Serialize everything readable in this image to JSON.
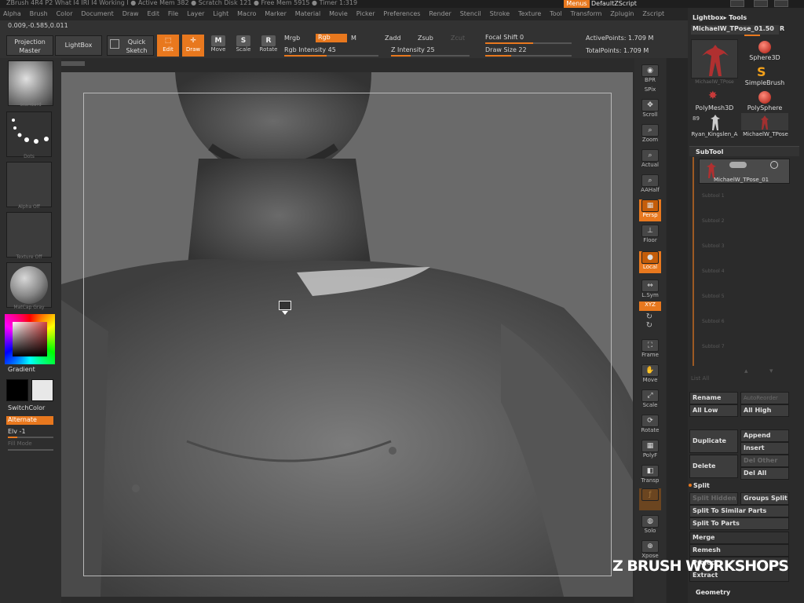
{
  "title_bar": {
    "text": "ZBrush 4R4 P2   What I4 IRI I4 Working I   ● Active Mem 382 ● Scratch Disk 121 ● Free Mem 5915 ● Timer 1:319",
    "menus_label": "Menus",
    "script_label": "DefaultZScript"
  },
  "menu": [
    "Alpha",
    "Brush",
    "Color",
    "Document",
    "Draw",
    "Edit",
    "File",
    "Layer",
    "Light",
    "Macro",
    "Marker",
    "Material",
    "Movie",
    "Picker",
    "Preferences",
    "Render",
    "Stencil",
    "Stroke",
    "Texture",
    "Tool",
    "Transform",
    "Zplugin",
    "Zscript"
  ],
  "toolbar": {
    "coords": "0.009,-0.585,0.011",
    "projection_master": "Projection Master",
    "lightbox": "LightBox",
    "quick_sketch": "Quick Sketch",
    "edit": "Edit",
    "draw": "Draw",
    "move": "Move",
    "scale": "Scale",
    "rotate": "Rotate",
    "mrgb": "Mrgb",
    "rgb": "Rgb",
    "m": "M",
    "rgb_intensity": "Rgb Intensity 45",
    "rgb_intensity_value": 45,
    "zadd": "Zadd",
    "zsub": "Zsub",
    "zcut": "Zcut",
    "z_intensity": "Z Intensity 25",
    "z_intensity_value": 25,
    "focal_shift": "Focal Shift 0",
    "draw_size": "Draw Size 22",
    "active_points": "ActivePoints: 1.709 M",
    "total_points": "TotalPoints: 1.709 M"
  },
  "left": {
    "brush_label": "Standard",
    "stroke_label": "Dots",
    "alpha_label": "Alpha  Off",
    "texture_label": "Texture  Off",
    "material_label": "MatCap  Gray",
    "gradient": "Gradient",
    "switch_color": "SwitchColor",
    "alternate": "Alternate",
    "elv": "Elv -1",
    "fill_mode": "Fill Mode",
    "colors": {
      "primary": "#000000",
      "secondary": "#e8e8e8",
      "accent": "#e8781e"
    }
  },
  "shelf": [
    "BPR",
    "SPix",
    "Scroll",
    "Zoom",
    "Actual",
    "AAHalf",
    "Persp",
    "Floor",
    "Local",
    "L.Sym",
    "XYZ",
    "Frame",
    "Move",
    "Scale",
    "Rotate",
    "PolyF",
    "Transp",
    "Ghost",
    "Solo",
    "Xpose"
  ],
  "right": {
    "lightbox_tools": "Lightbox▸ Tools",
    "current_tool": "MichaelW_TPose_01.50",
    "r_btn": "R",
    "tools": [
      "MichaelW_TPose",
      "Sphere3D",
      "SimpleBrush",
      "PolyMesh3D",
      "PolySphere",
      "Ryan_Kingslen_A",
      "MichaelW_TPose"
    ],
    "tool_count": "89",
    "subtool_header": "SubTool",
    "subtool_name": "MichaelW_TPose_01",
    "subtool_slots": [
      "Subtool 1",
      "Subtool 2",
      "Subtool 3",
      "Subtool 4",
      "Subtool 5",
      "Subtool 6",
      "Subtool 7"
    ],
    "list_all": "List All",
    "rename": "Rename",
    "autoreorder": "AutoReorder",
    "all_low": "All Low",
    "all_high": "All High",
    "duplicate": "Duplicate",
    "append": "Append",
    "insert": "Insert",
    "delete": "Delete",
    "del_other": "Del Other",
    "del_all": "Del All",
    "split": "Split",
    "split_hidden": "Split Hidden",
    "groups_split": "Groups Split",
    "split_similar": "Split To Similar Parts",
    "split_parts": "Split To Parts",
    "merge": "Merge",
    "remesh": "Remesh",
    "project": "Project",
    "extract": "Extract",
    "geometry": "Geometry"
  },
  "watermark": "Z BRUSH WORKSHOPS"
}
